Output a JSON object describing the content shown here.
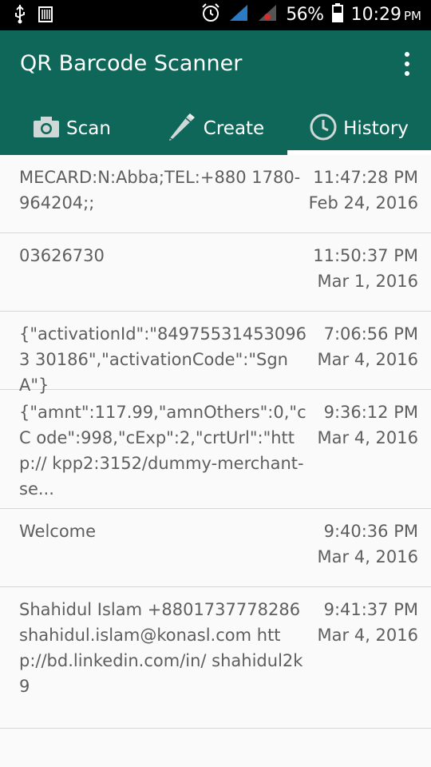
{
  "status_bar": {
    "battery": "56%",
    "time": "10:29",
    "ampm": "PM",
    "icons": [
      "usb-icon",
      "barcode-icon",
      "alarm-icon",
      "signal-icon",
      "signal-roaming-icon",
      "battery-icon"
    ]
  },
  "app": {
    "title": "QR Barcode Scanner",
    "accent": "#0e6759"
  },
  "tabs": [
    {
      "label": "Scan",
      "icon": "camera-icon"
    },
    {
      "label": "Create",
      "icon": "pencil-icon"
    },
    {
      "label": "History",
      "icon": "clock-icon",
      "active": true
    }
  ],
  "history": [
    {
      "content": "MECARD:N:Abba;TEL:+880 1780-964204;;",
      "time": "11:47:28 PM",
      "date": "Feb 24, 2016"
    },
    {
      "content": "03626730",
      "time": "11:50:37 PM",
      "date": "Mar 1, 2016"
    },
    {
      "content": "{\"activationId\":\"849755314530963 30186\",\"activationCode\":\"SgnA\"}",
      "time": "7:06:56 PM",
      "date": "Mar 4, 2016"
    },
    {
      "content": "{\"amnt\":117.99,\"amnOthers\":0,\"cC ode\":998,\"cExp\":2,\"crtUrl\":\"http:// kpp2:3152/dummy-merchant- se...",
      "time": "9:36:12 PM",
      "date": "Mar 4, 2016"
    },
    {
      "content": "Welcome",
      "time": "9:40:36 PM",
      "date": "Mar 4, 2016"
    },
    {
      "content": "Shahidul Islam +8801737778286 shahidul.islam@konasl.com http://bd.linkedin.com/in/ shahidul2k9",
      "time": "9:41:37 PM",
      "date": "Mar 4, 2016"
    }
  ]
}
